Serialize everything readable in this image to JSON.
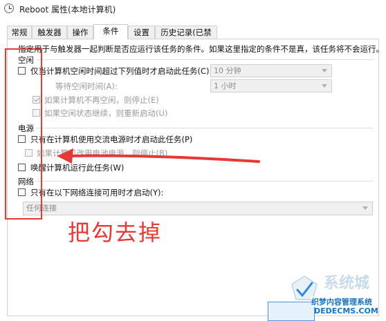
{
  "window": {
    "title": "Reboot 属性(本地计算机)"
  },
  "tabs": [
    {
      "label": "常规"
    },
    {
      "label": "触发器"
    },
    {
      "label": "操作"
    },
    {
      "label": "条件"
    },
    {
      "label": "设置"
    },
    {
      "label": "历史记录(已禁用)"
    }
  ],
  "active_tab": "条件",
  "description": "指定用于与触发器一起判断是否应运行该任务的条件。如果这里指定的条件不是真，该任务将不会运行。",
  "idle": {
    "heading": "空闲",
    "start_only_idle": {
      "label": "仅当计算机空闲时间超过下列值时才启动此任务(C):",
      "checked": false,
      "select_value": "10 分钟"
    },
    "wait_idle": {
      "label": "等待空闲时间(A):",
      "select_value": "1 小时"
    },
    "stop_if_not_idle": {
      "label": "如果计算机不再空闲，则停止(E)",
      "checked": true
    },
    "restart_if_idle": {
      "label": "如果空闲状态继续，则重新启动(U)",
      "checked": false
    }
  },
  "power": {
    "heading": "电源",
    "ac_only": {
      "label": "只有在计算机使用交流电源时才启动此任务(P)",
      "checked": false
    },
    "stop_on_battery": {
      "label": "如果计算机改用电池电源，则停止(B)",
      "checked": false
    },
    "wake_to_run": {
      "label": "唤醒计算机运行此任务(W)",
      "checked": false
    }
  },
  "network": {
    "heading": "网络",
    "only_if_network": {
      "label": "只有在以下网络连接可用时才启动(Y):",
      "checked": false
    },
    "connection_value": "任何连接"
  },
  "annotation": {
    "text": "把勾去掉",
    "color": "#e53935"
  },
  "watermark": {
    "title": "系统城",
    "subtitle": "织梦内容管理系统",
    "url": "DEDECMS.COM"
  }
}
